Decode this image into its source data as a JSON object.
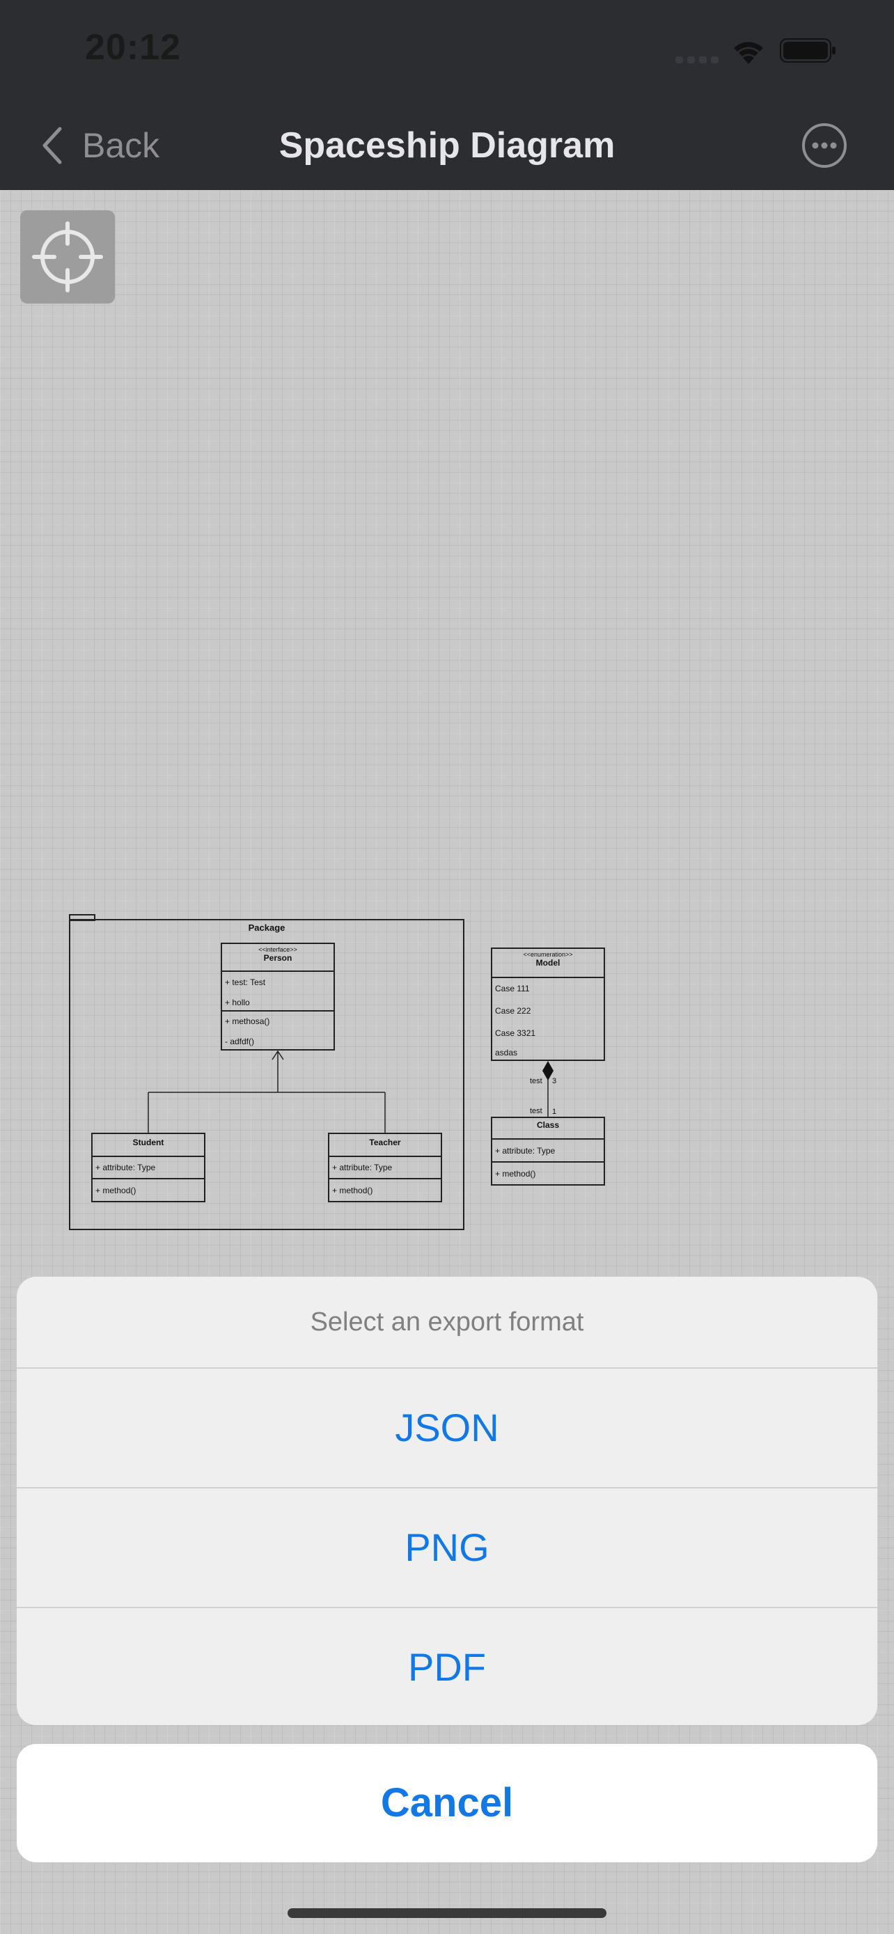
{
  "status_bar": {
    "time": "20:12"
  },
  "nav": {
    "back_label": "Back",
    "title": "Spaceship Diagram"
  },
  "icons": {
    "back": "chevron-left-icon",
    "more": "ellipsis-circle-icon",
    "recenter": "crosshair-icon",
    "wifi": "wifi-icon",
    "battery": "battery-icon",
    "signal": "cellular-signal-icon"
  },
  "diagram": {
    "package": {
      "name": "Package"
    },
    "person": {
      "stereotype": "<<interface>>",
      "name": "Person",
      "attributes": [
        "+ test: Test",
        "+ hollo"
      ],
      "methods": [
        "+ methosa()",
        "- adfdf()"
      ]
    },
    "student": {
      "name": "Student",
      "attribute": "+ attribute: Type",
      "method": "+ method()"
    },
    "teacher": {
      "name": "Teacher",
      "attribute": "+ attribute: Type",
      "method": "+ method()"
    },
    "model": {
      "stereotype": "<<enumeration>>",
      "name": "Model",
      "cases": [
        "Case 111",
        "Case 222",
        "Case 3321",
        "asdas"
      ]
    },
    "class_box": {
      "name": "Class",
      "attribute": "+ attribute: Type",
      "method": "+ method()"
    },
    "association": {
      "upper_label": "test",
      "upper_multiplicity": "3",
      "lower_label": "test",
      "lower_multiplicity": "1"
    }
  },
  "export_sheet": {
    "title": "Select an export format",
    "options": [
      "JSON",
      "PNG",
      "PDF"
    ],
    "cancel_label": "Cancel"
  },
  "colors": {
    "accent": "#1278e6",
    "bar": "#2c2d31",
    "canvas": "#c9c9c9"
  }
}
